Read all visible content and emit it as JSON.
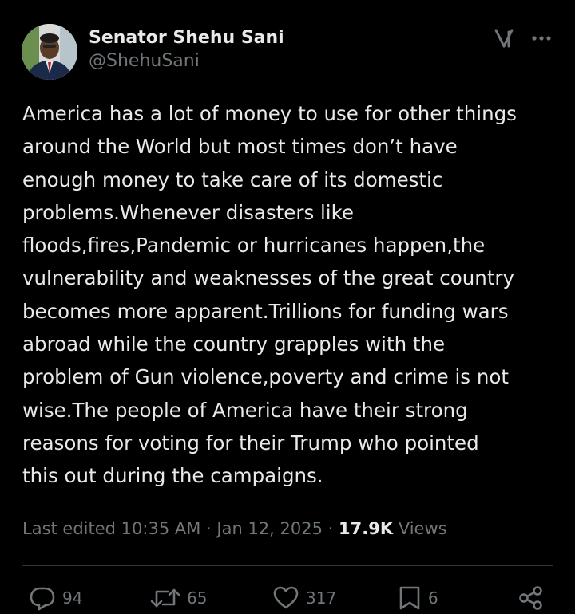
{
  "author": {
    "display_name": "Senator Shehu Sani",
    "handle": "@ShehuSani"
  },
  "icons": {
    "grok": "grok-icon",
    "more": "more-icon",
    "reply": "reply-icon",
    "retweet": "retweet-icon",
    "like": "heart-icon",
    "bookmark": "bookmark-icon",
    "share": "share-icon"
  },
  "post": {
    "text": "America has a lot of money to use for other things\naround the World but most times don’t have\nenough money to take care of its domestic\nproblems.Whenever disasters like\nfloods,fires,Pandemic or hurricanes happen,the\nvulnerability and weaknesses of the great country\nbecomes more apparent.Trillions for funding wars\nabroad while the country grapples with the\nproblem of Gun violence,poverty and crime is not\nwise.The people of America have their strong\nreasons for voting for their Trump who pointed\nthis out during the campaigns."
  },
  "meta": {
    "edited_label": "Last edited 10:35 AM",
    "separator": "·",
    "date": "Jan 12, 2025",
    "views_count": "17.9K",
    "views_label": "Views"
  },
  "actions": {
    "replies": "94",
    "reposts": "65",
    "likes": "317",
    "bookmarks": "6"
  },
  "colors": {
    "background": "#000000",
    "primary_text": "#e7e9ea",
    "secondary_text": "#71767b",
    "divider": "#2f3336"
  }
}
